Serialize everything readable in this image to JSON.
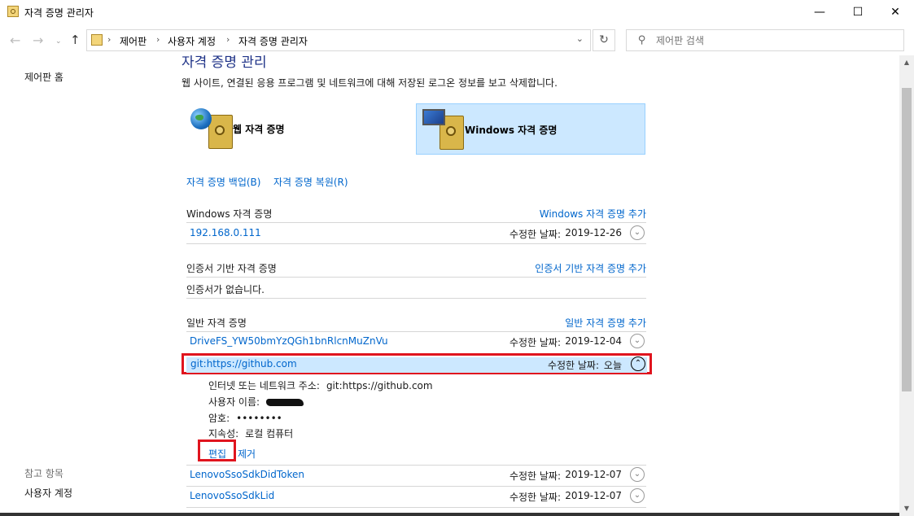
{
  "window": {
    "title": "자격 증명 관리자",
    "minimize_glyph": "—",
    "maximize_glyph": "☐",
    "close_glyph": "✕"
  },
  "address": {
    "back_glyph": "←",
    "forward_glyph": "→",
    "up_glyph": "↑",
    "breadcrumbs": [
      "제어판",
      "사용자 계정",
      "자격 증명 관리자"
    ],
    "separator": "›",
    "dropdown_glyph": "⌄",
    "refresh_glyph": "↻",
    "search_placeholder": "제어판 검색",
    "search_glyph": "⚲"
  },
  "sidebar": {
    "home_link": "제어판 홈",
    "see_also_heading": "참고 항목",
    "see_also_items": [
      "사용자 계정"
    ]
  },
  "main": {
    "title": "자격 증명 관리",
    "description": "웹 사이트, 연결된 응용 프로그램 및 네트워크에 대해 저장된 로그온 정보를 보고 삭제합니다.",
    "tiles": [
      {
        "label": "웹 자격 증명",
        "selected": false
      },
      {
        "label": "Windows 자격 증명",
        "selected": true
      }
    ],
    "backup_link": "자격 증명 백업(B)",
    "restore_link": "자격 증명 복원(R)",
    "sections": {
      "windows": {
        "title": "Windows 자격 증명",
        "add_link": "Windows 자격 증명 추가",
        "items": [
          {
            "name": "192.168.0.111",
            "date_label": "수정한 날짜:",
            "date": "2019-12-26"
          }
        ]
      },
      "certificate": {
        "title": "인증서 기반 자격 증명",
        "add_link": "인증서 기반 자격 증명 추가",
        "empty_text": "인증서가 없습니다."
      },
      "generic": {
        "title": "일반 자격 증명",
        "add_link": "일반 자격 증명 추가",
        "items": [
          {
            "name": "DriveFS_YW50bmYzQGh1bnRlcnMuZnVu",
            "date_label": "수정한 날짜:",
            "date": "2019-12-04"
          },
          {
            "name": "git:https://github.com",
            "date_label": "수정한 날짜:",
            "date": "오늘"
          },
          {
            "name": "LenovoSsoSdkDidToken",
            "date_label": "수정한 날짜:",
            "date": "2019-12-07"
          },
          {
            "name": "LenovoSsoSdkLid",
            "date_label": "수정한 날짜:",
            "date": "2019-12-07"
          }
        ],
        "expanded_details": {
          "address_label": "인터넷 또는 네트워크 주소:",
          "address_value": "git:https://github.com",
          "username_label": "사용자 이름:",
          "password_label": "암호:",
          "password_value": "••••••••",
          "persistence_label": "지속성:",
          "persistence_value": "로컬 컴퓨터",
          "edit_link": "편집",
          "remove_link": "제거"
        }
      }
    }
  },
  "colors": {
    "link": "#0066cc",
    "highlight": "#cce8ff",
    "annotation_red": "#e0141e",
    "title_blue": "#1e3287"
  }
}
